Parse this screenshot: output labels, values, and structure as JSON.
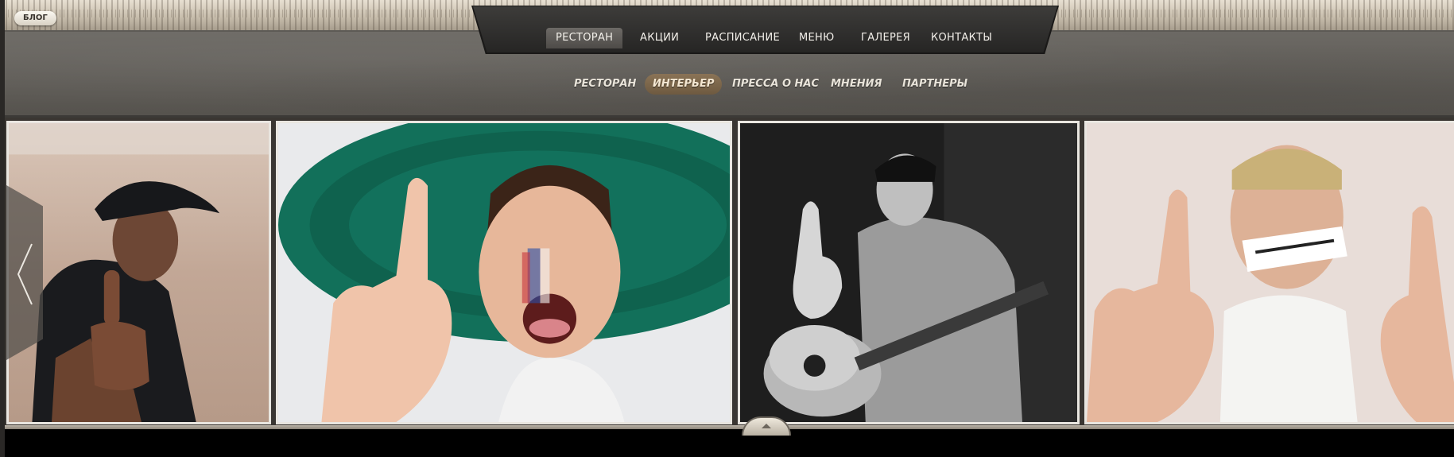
{
  "top_bar": {
    "blog_label": "БЛОГ"
  },
  "main_nav": {
    "items": [
      {
        "label": "РЕСТОРАН",
        "active": true
      },
      {
        "label": "АКЦИИ",
        "active": false
      },
      {
        "label": "РАСПИСАНИЕ",
        "active": false
      },
      {
        "label": "МЕНЮ",
        "active": false
      },
      {
        "label": "ГАЛЕРЕЯ",
        "active": false
      },
      {
        "label": "КОНТАКТЫ",
        "active": false
      }
    ]
  },
  "sub_nav": {
    "items": [
      {
        "label": "РЕСТОРАН",
        "active": false
      },
      {
        "label": "ИНТЕРЬЕР",
        "active": true
      },
      {
        "label": "ПРЕССА О НАС",
        "active": false
      },
      {
        "label": "МНЕНИЯ",
        "active": false
      },
      {
        "label": "ПАРТНЕРЫ",
        "active": false
      }
    ]
  },
  "gallery": {
    "photos": [
      {
        "name": "photo-man-black-cap"
      },
      {
        "name": "photo-child-green-hat"
      },
      {
        "name": "photo-man-guitar-bw"
      },
      {
        "name": "photo-man-taped-mouth"
      }
    ],
    "prev_icon": "chevron-left-icon",
    "scroll_icon": "chevron-up-icon"
  },
  "colors": {
    "header_gray": "#605d58",
    "nav_dark": "#2f2e2c",
    "sub_active": "#7b6549",
    "photo_border": "#e9e6e0"
  }
}
